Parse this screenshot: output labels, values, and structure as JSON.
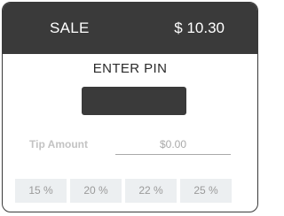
{
  "header": {
    "title": "SALE",
    "amount": "$ 10.30"
  },
  "pin": {
    "prompt": "ENTER PIN"
  },
  "tip": {
    "label": "Tip Amount",
    "value": "$0.00",
    "options": [
      "15 %",
      "20 %",
      "22 %",
      "25 %"
    ]
  },
  "colors": {
    "header_bg": "#3a3a3a",
    "header_text": "#ffffff",
    "pin_box": "#3a3a3a",
    "tip_button_bg": "#eceff1"
  }
}
